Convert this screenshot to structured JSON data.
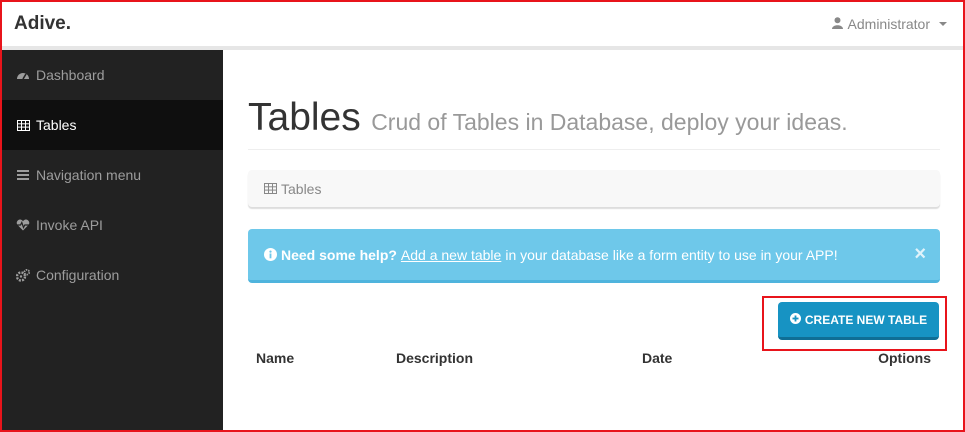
{
  "navbar": {
    "brand": "Adive.",
    "user": "Administrator"
  },
  "sidebar": {
    "items": [
      {
        "label": "Dashboard",
        "icon": "dashboard-icon",
        "active": false
      },
      {
        "label": "Tables",
        "icon": "table-icon",
        "active": true
      },
      {
        "label": "Navigation menu",
        "icon": "bars-icon",
        "active": false
      },
      {
        "label": "Invoke API",
        "icon": "heartbeat-icon",
        "active": false
      },
      {
        "label": "Configuration",
        "icon": "cogs-icon",
        "active": false
      }
    ]
  },
  "header": {
    "title": "Tables",
    "subtitle": "Crud of Tables in Database, deploy your ideas."
  },
  "breadcrumb": {
    "label": "Tables"
  },
  "alert": {
    "strong": "Need some help?",
    "link": "Add a new table",
    "text": "in your database like a form entity to use in your APP!",
    "close": "×"
  },
  "actions": {
    "create_label": "CREATE NEW TABLE"
  },
  "table": {
    "columns": [
      "Name",
      "Description",
      "Date",
      "Options"
    ]
  },
  "colors": {
    "sidebar_bg": "#222222",
    "alert_bg": "#6ec8ea",
    "button_bg": "#1793c3",
    "highlight": "#e8141b"
  }
}
